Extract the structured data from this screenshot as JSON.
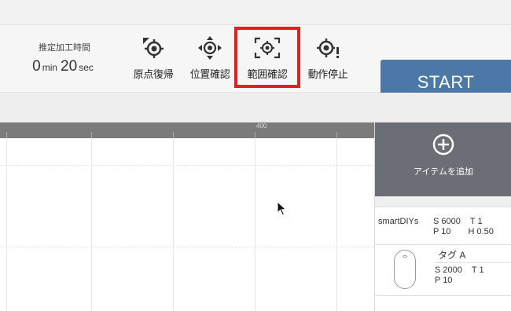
{
  "toolbar": {
    "time": {
      "label": "推定加工時間",
      "minutes": "0",
      "min_unit": "min",
      "seconds": "20",
      "sec_unit": "sec"
    },
    "tools": [
      {
        "label": "原点復帰",
        "icon": "home-origin-icon"
      },
      {
        "label": "位置確認",
        "icon": "position-check-icon"
      },
      {
        "label": "範囲確認",
        "icon": "range-check-icon"
      },
      {
        "label": "動作停止",
        "icon": "stop-operation-icon"
      }
    ],
    "start_label": "START",
    "highlight_color": "#e51f1f",
    "start_color": "#4c78a8"
  },
  "ruler": {
    "label": "400"
  },
  "panel": {
    "add_item_label": "アイテムを追加",
    "items": [
      {
        "name": "smartDIYs",
        "s": "S 6000",
        "t": "T 1",
        "p": "P 10",
        "h": "H 0.50"
      },
      {
        "name": "タグ A",
        "s": "S 2000",
        "t": "T 1",
        "p": "P 10"
      }
    ]
  }
}
